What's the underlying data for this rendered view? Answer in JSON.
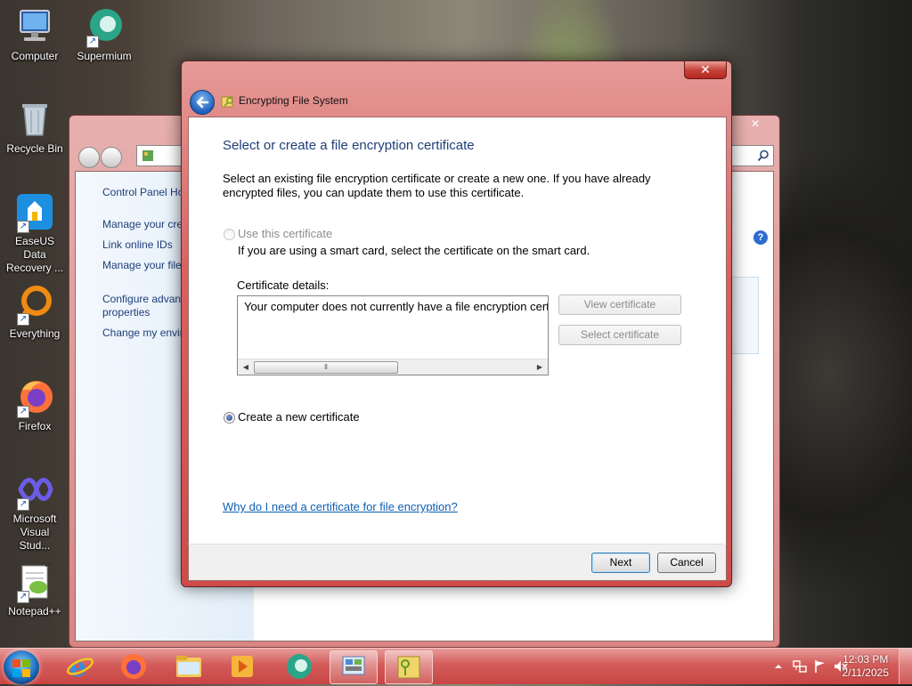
{
  "desktop": {
    "icons": [
      {
        "label": "Computer"
      },
      {
        "label": "Supermium"
      },
      {
        "label": "Recycle Bin"
      },
      {
        "label": "EaseUS Data Recovery ..."
      },
      {
        "label": "Everything"
      },
      {
        "label": "Firefox"
      },
      {
        "label": "Microsoft Visual Stud..."
      },
      {
        "label": "Notepad++"
      }
    ]
  },
  "background_window": {
    "close_label": "✕",
    "left_pane": {
      "home": "Control Panel Ho",
      "items": [
        "Manage your cre",
        "Link online IDs",
        "Manage your file certificates",
        "Configure advanc profile properties",
        "Change my envir variables"
      ]
    },
    "help_label": "?"
  },
  "dialog": {
    "title": "Encrypting File System",
    "close_label": "✕",
    "heading": "Select or create a file encryption certificate",
    "description": "Select an existing file encryption certificate or create a new one. If you have already encrypted files, you can update them to use this certificate.",
    "use_cert": {
      "label": "Use this certificate",
      "hint": "If you are using a smart card, select the certificate on the smart card.",
      "checked": false,
      "enabled": false
    },
    "cert_details": {
      "label": "Certificate details:",
      "text": "Your computer does not currently have a file encryption certificate."
    },
    "view_certificate_label": "View certificate",
    "select_certificate_label": "Select certificate",
    "create_new": {
      "label": "Create a new certificate",
      "checked": true
    },
    "help_link": "Why do I need a certificate for file encryption?",
    "next_label": "Next",
    "cancel_label": "Cancel"
  },
  "taskbar": {
    "items": [
      "Internet Explorer",
      "Firefox",
      "File Explorer",
      "Media Player",
      "Supermium",
      "Control Panel",
      "Encrypting File System"
    ],
    "clock": {
      "time": "12:03 PM",
      "date": "2/11/2025"
    }
  }
}
